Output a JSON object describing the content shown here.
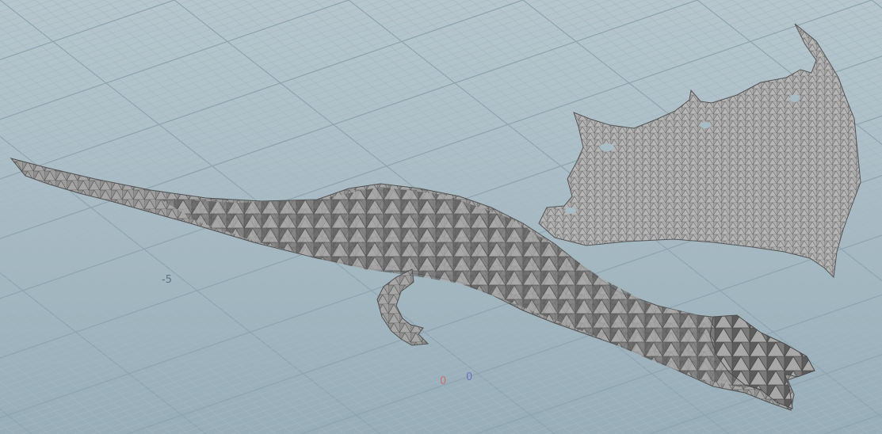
{
  "viewport": {
    "background_top": "#b7c6cd",
    "background_bottom": "#97adb8",
    "grid_minor_color": "#a4b8c2",
    "grid_major_color": "#8ea4af",
    "mesh_fill": "#9a9a9a",
    "mesh_line": "#5e5e5e",
    "mesh_shadow": "#4a4a4a"
  },
  "grid_labels": {
    "minus_five": "-5",
    "origin_x": "0",
    "origin_z": "0"
  },
  "axis_colors": {
    "x_axis": "#c97070",
    "z_axis": "#7070c0"
  },
  "model": {
    "name_icon": "dragon-mesh"
  }
}
